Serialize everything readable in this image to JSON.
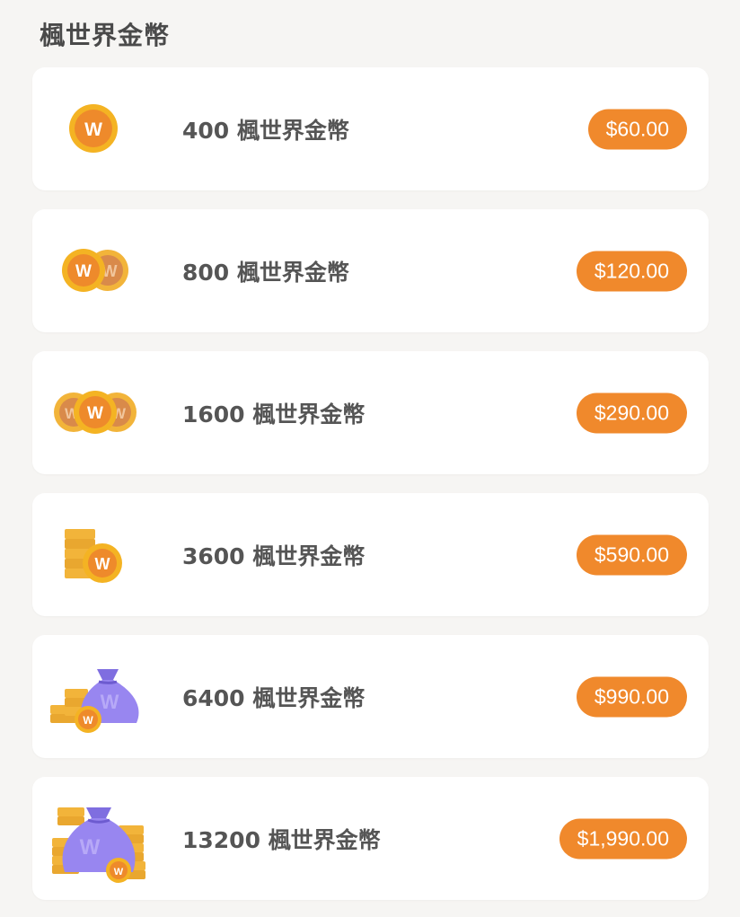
{
  "page": {
    "title": "楓世界金幣"
  },
  "colors": {
    "background": "#f6f5f3",
    "card": "#ffffff",
    "accent": "#f0892c",
    "text": "#555555"
  },
  "packages": [
    {
      "label": "400 楓世界金幣",
      "price": "$60.00",
      "icon": "single-coin-icon"
    },
    {
      "label": "800 楓世界金幣",
      "price": "$120.00",
      "icon": "two-coins-icon"
    },
    {
      "label": "1600 楓世界金幣",
      "price": "$290.00",
      "icon": "three-coins-icon"
    },
    {
      "label": "3600 楓世界金幣",
      "price": "$590.00",
      "icon": "coin-stack-icon"
    },
    {
      "label": "6400 楓世界金幣",
      "price": "$990.00",
      "icon": "coin-bag-icon"
    },
    {
      "label": "13200 楓世界金幣",
      "price": "$1,990.00",
      "icon": "large-coin-bag-icon"
    }
  ]
}
